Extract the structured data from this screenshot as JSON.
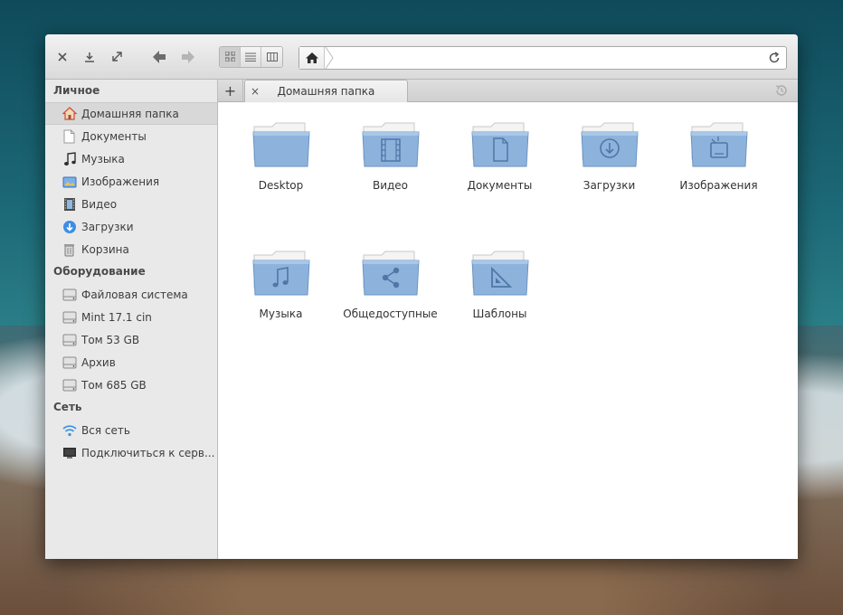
{
  "toolbar": {
    "close_icon": "close-icon",
    "download_icon": "download-icon",
    "maximize_icon": "maximize-icon",
    "back_icon": "back-arrow-icon",
    "forward_icon": "forward-arrow-icon",
    "view_modes": [
      "icon-view",
      "list-view",
      "column-view"
    ],
    "active_view": "icon-view"
  },
  "pathbar": {
    "home_icon": "home-icon",
    "value": "",
    "reload_icon": "reload-icon"
  },
  "sidebar": {
    "sections": [
      {
        "heading": "Личное",
        "items": [
          {
            "label": "Домашняя папка",
            "icon": "home-icon",
            "selected": true
          },
          {
            "label": "Документы",
            "icon": "document-icon"
          },
          {
            "label": "Музыка",
            "icon": "music-icon"
          },
          {
            "label": "Изображения",
            "icon": "pictures-icon"
          },
          {
            "label": "Видео",
            "icon": "video-icon"
          },
          {
            "label": "Загрузки",
            "icon": "download-icon"
          },
          {
            "label": "Корзина",
            "icon": "trash-icon"
          }
        ]
      },
      {
        "heading": "Оборудование",
        "items": [
          {
            "label": "Файловая система",
            "icon": "drive-icon"
          },
          {
            "label": "Mint 17.1 cin",
            "icon": "drive-icon"
          },
          {
            "label": "Том 53 GB",
            "icon": "drive-icon"
          },
          {
            "label": "Архив",
            "icon": "drive-icon"
          },
          {
            "label": "Том 685 GB",
            "icon": "drive-icon"
          }
        ]
      },
      {
        "heading": "Сеть",
        "items": [
          {
            "label": "Вся сеть",
            "icon": "wifi-icon"
          },
          {
            "label": "Подключиться к серв...",
            "icon": "server-icon"
          }
        ]
      }
    ]
  },
  "tabs": {
    "add_label": "+",
    "close_label": "×",
    "items": [
      {
        "label": "Домашняя папка"
      }
    ]
  },
  "folders": [
    {
      "label": "Desktop",
      "emblem": "none"
    },
    {
      "label": "Видео",
      "emblem": "film"
    },
    {
      "label": "Документы",
      "emblem": "document"
    },
    {
      "label": "Загрузки",
      "emblem": "download"
    },
    {
      "label": "Изображения",
      "emblem": "picture"
    },
    {
      "label": "Музыка",
      "emblem": "music"
    },
    {
      "label": "Общедоступные",
      "emblem": "share"
    },
    {
      "label": "Шаблоны",
      "emblem": "template"
    }
  ],
  "colors": {
    "folder_body": "#8db3dd",
    "folder_body_dark": "#6a93c2",
    "folder_paper": "#f4f4f4",
    "accent_blue": "#3a8ee6"
  }
}
